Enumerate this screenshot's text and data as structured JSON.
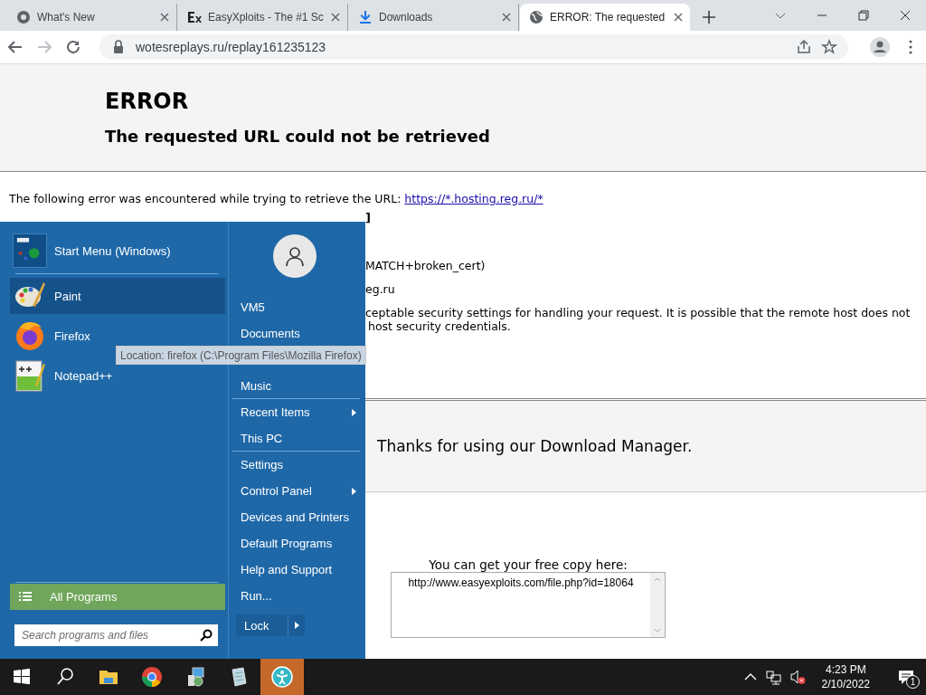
{
  "browser": {
    "tabs": [
      {
        "title": "What's New",
        "selected": false
      },
      {
        "title": "EasyXploits - The #1 Sc",
        "selected": false
      },
      {
        "title": "Downloads",
        "selected": false
      },
      {
        "title": "ERROR: The requested",
        "selected": true
      }
    ],
    "address": "wotesreplays.ru/replay161235123"
  },
  "page": {
    "heading": "ERROR",
    "subheading": "The requested URL could not be retrieved",
    "intro": "The following error was encountered while trying to retrieve the URL: ",
    "intro_link": "https://*.hosting.reg.ru/*",
    "fragments": [
      {
        "text": "]",
        "bold": true
      },
      {
        "text": "MATCH+broken_cert)",
        "bold": false
      },
      {
        "text": "eg.ru",
        "bold": false
      },
      {
        "text": "ceptable security settings for handling your request. It is possible that the remote host does not",
        "bold": false
      },
      {
        "text": "host security credentials.",
        "bold": false
      }
    ],
    "thanks": "Thanks for using our Download Manager.",
    "copy_label": "You can get your free copy here:",
    "copy_value": "http://www.easyexploits.com/file.php?id=18064"
  },
  "start_menu": {
    "header": "Start Menu (Windows)",
    "pinned": [
      {
        "label": "Paint",
        "selected": true
      },
      {
        "label": "Firefox",
        "selected": false
      },
      {
        "label": "Notepad++",
        "selected": false
      }
    ],
    "all_programs": "All Programs",
    "search": {
      "placeholder": "Search programs and files"
    },
    "places": [
      {
        "label": "VM5",
        "submenu": false,
        "separator_after": false
      },
      {
        "label": "Documents",
        "submenu": false,
        "separator_after": false,
        "gap_after": true
      },
      {
        "label": "Music",
        "submenu": false,
        "separator_after": true
      },
      {
        "label": "Recent Items",
        "submenu": true,
        "separator_after": false
      },
      {
        "label": "This PC",
        "submenu": false,
        "separator_after": true
      },
      {
        "label": "Settings",
        "submenu": false,
        "separator_after": false
      },
      {
        "label": "Control Panel",
        "submenu": true,
        "separator_after": false
      },
      {
        "label": "Devices and Printers",
        "submenu": false,
        "separator_after": false
      },
      {
        "label": "Default Programs",
        "submenu": false,
        "separator_after": false
      },
      {
        "label": "Help and Support",
        "submenu": false,
        "separator_after": false
      },
      {
        "label": "Run...",
        "submenu": false,
        "separator_after": false
      }
    ],
    "lock": "Lock",
    "tooltip": "Location: firefox (C:\\Program Files\\Mozilla Firefox)"
  },
  "taskbar": {
    "clock_time": "4:23 PM",
    "clock_date": "2/10/2022",
    "notifications": "1"
  }
}
